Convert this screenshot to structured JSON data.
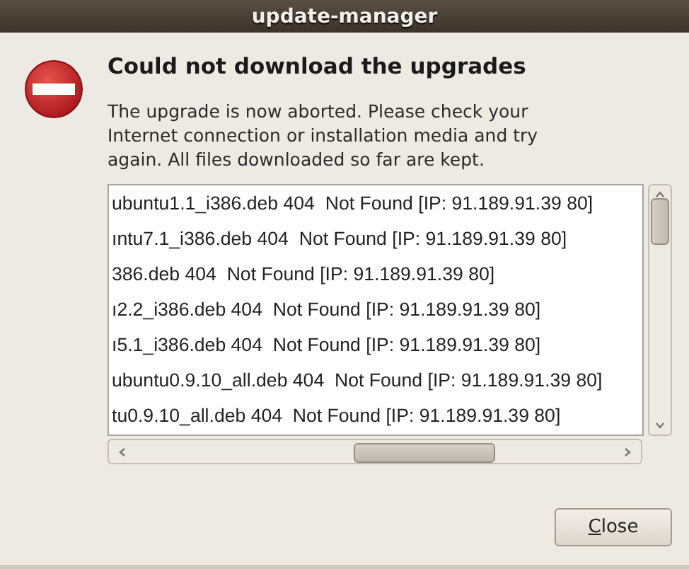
{
  "window": {
    "title": "update-manager"
  },
  "heading": "Could not download the upgrades",
  "message": "The upgrade is now aborted. Please check your Internet connection or installation media and try again. All files downloaded so far are kept.",
  "log_lines": [
    "ubuntu1.1_i386.deb 404  Not Found [IP: 91.189.91.39 80]",
    "ıntu7.1_i386.deb 404  Not Found [IP: 91.189.91.39 80]",
    "386.deb 404  Not Found [IP: 91.189.91.39 80]",
    "ı2.2_i386.deb 404  Not Found [IP: 91.189.91.39 80]",
    "ı5.1_i386.deb 404  Not Found [IP: 91.189.91.39 80]",
    "ubuntu0.9.10_all.deb 404  Not Found [IP: 91.189.91.39 80]",
    "tu0.9.10_all.deb 404  Not Found [IP: 91.189.91.39 80]"
  ],
  "buttons": [
    {
      "label": "Close",
      "mnemonic": true
    }
  ]
}
